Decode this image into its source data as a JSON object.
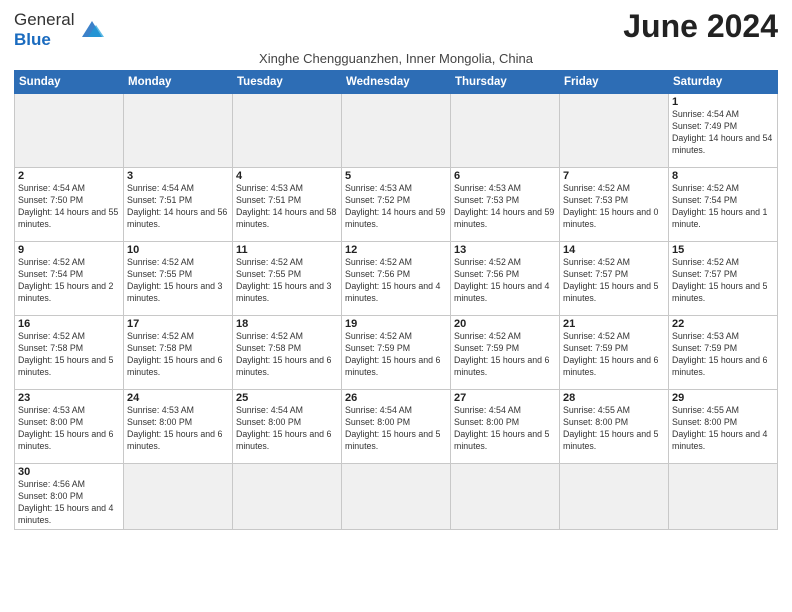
{
  "logo": {
    "text_general": "General",
    "text_blue": "Blue"
  },
  "title": "June 2024",
  "subtitle": "Xinghe Chengguanzhen, Inner Mongolia, China",
  "header_days": [
    "Sunday",
    "Monday",
    "Tuesday",
    "Wednesday",
    "Thursday",
    "Friday",
    "Saturday"
  ],
  "weeks": [
    [
      {
        "day": "",
        "empty": true
      },
      {
        "day": "",
        "empty": true
      },
      {
        "day": "",
        "empty": true
      },
      {
        "day": "",
        "empty": true
      },
      {
        "day": "",
        "empty": true
      },
      {
        "day": "",
        "empty": true
      },
      {
        "day": "1",
        "sunrise": "4:54 AM",
        "sunset": "7:49 PM",
        "daylight": "14 hours and 54 minutes."
      }
    ],
    [
      {
        "day": "2",
        "sunrise": "4:54 AM",
        "sunset": "7:50 PM",
        "daylight": "14 hours and 55 minutes."
      },
      {
        "day": "3",
        "sunrise": "4:54 AM",
        "sunset": "7:51 PM",
        "daylight": "14 hours and 56 minutes."
      },
      {
        "day": "4",
        "sunrise": "4:53 AM",
        "sunset": "7:51 PM",
        "daylight": "14 hours and 58 minutes."
      },
      {
        "day": "5",
        "sunrise": "4:53 AM",
        "sunset": "7:52 PM",
        "daylight": "14 hours and 59 minutes."
      },
      {
        "day": "6",
        "sunrise": "4:53 AM",
        "sunset": "7:53 PM",
        "daylight": "14 hours and 59 minutes."
      },
      {
        "day": "7",
        "sunrise": "4:52 AM",
        "sunset": "7:53 PM",
        "daylight": "15 hours and 0 minutes."
      },
      {
        "day": "8",
        "sunrise": "4:52 AM",
        "sunset": "7:54 PM",
        "daylight": "15 hours and 1 minute."
      }
    ],
    [
      {
        "day": "9",
        "sunrise": "4:52 AM",
        "sunset": "7:54 PM",
        "daylight": "15 hours and 2 minutes."
      },
      {
        "day": "10",
        "sunrise": "4:52 AM",
        "sunset": "7:55 PM",
        "daylight": "15 hours and 3 minutes."
      },
      {
        "day": "11",
        "sunrise": "4:52 AM",
        "sunset": "7:55 PM",
        "daylight": "15 hours and 3 minutes."
      },
      {
        "day": "12",
        "sunrise": "4:52 AM",
        "sunset": "7:56 PM",
        "daylight": "15 hours and 4 minutes."
      },
      {
        "day": "13",
        "sunrise": "4:52 AM",
        "sunset": "7:56 PM",
        "daylight": "15 hours and 4 minutes."
      },
      {
        "day": "14",
        "sunrise": "4:52 AM",
        "sunset": "7:57 PM",
        "daylight": "15 hours and 5 minutes."
      },
      {
        "day": "15",
        "sunrise": "4:52 AM",
        "sunset": "7:57 PM",
        "daylight": "15 hours and 5 minutes."
      }
    ],
    [
      {
        "day": "16",
        "sunrise": "4:52 AM",
        "sunset": "7:58 PM",
        "daylight": "15 hours and 5 minutes."
      },
      {
        "day": "17",
        "sunrise": "4:52 AM",
        "sunset": "7:58 PM",
        "daylight": "15 hours and 6 minutes."
      },
      {
        "day": "18",
        "sunrise": "4:52 AM",
        "sunset": "7:58 PM",
        "daylight": "15 hours and 6 minutes."
      },
      {
        "day": "19",
        "sunrise": "4:52 AM",
        "sunset": "7:59 PM",
        "daylight": "15 hours and 6 minutes."
      },
      {
        "day": "20",
        "sunrise": "4:52 AM",
        "sunset": "7:59 PM",
        "daylight": "15 hours and 6 minutes."
      },
      {
        "day": "21",
        "sunrise": "4:52 AM",
        "sunset": "7:59 PM",
        "daylight": "15 hours and 6 minutes."
      },
      {
        "day": "22",
        "sunrise": "4:53 AM",
        "sunset": "7:59 PM",
        "daylight": "15 hours and 6 minutes."
      }
    ],
    [
      {
        "day": "23",
        "sunrise": "4:53 AM",
        "sunset": "8:00 PM",
        "daylight": "15 hours and 6 minutes."
      },
      {
        "day": "24",
        "sunrise": "4:53 AM",
        "sunset": "8:00 PM",
        "daylight": "15 hours and 6 minutes."
      },
      {
        "day": "25",
        "sunrise": "4:54 AM",
        "sunset": "8:00 PM",
        "daylight": "15 hours and 6 minutes."
      },
      {
        "day": "26",
        "sunrise": "4:54 AM",
        "sunset": "8:00 PM",
        "daylight": "15 hours and 5 minutes."
      },
      {
        "day": "27",
        "sunrise": "4:54 AM",
        "sunset": "8:00 PM",
        "daylight": "15 hours and 5 minutes."
      },
      {
        "day": "28",
        "sunrise": "4:55 AM",
        "sunset": "8:00 PM",
        "daylight": "15 hours and 5 minutes."
      },
      {
        "day": "29",
        "sunrise": "4:55 AM",
        "sunset": "8:00 PM",
        "daylight": "15 hours and 4 minutes."
      }
    ],
    [
      {
        "day": "30",
        "sunrise": "4:56 AM",
        "sunset": "8:00 PM",
        "daylight": "15 hours and 4 minutes."
      },
      {
        "day": "",
        "empty": true
      },
      {
        "day": "",
        "empty": true
      },
      {
        "day": "",
        "empty": true
      },
      {
        "day": "",
        "empty": true
      },
      {
        "day": "",
        "empty": true
      },
      {
        "day": "",
        "empty": true
      }
    ]
  ],
  "accent_color": "#2d6db5"
}
